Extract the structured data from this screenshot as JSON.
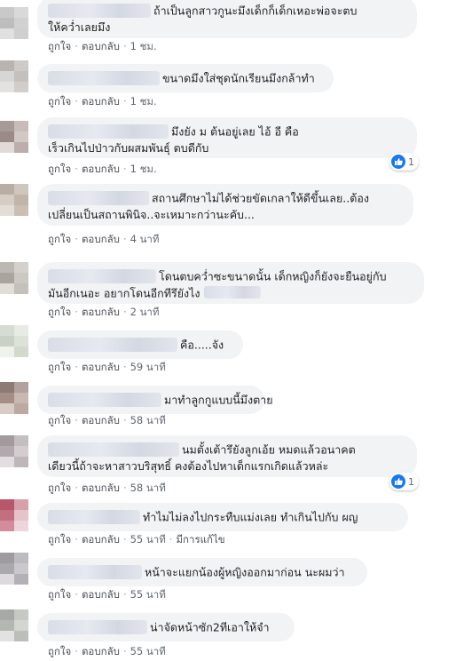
{
  "labels": {
    "like": "ถูกใจ",
    "reply": "ตอบกลับ",
    "separator": "·"
  },
  "colors": {
    "link": "#4b4f56",
    "bubble": "#f2f3f5",
    "like_blue": "#1877f2"
  },
  "comments": [
    {
      "lines": [
        "ถ้าเป็นลูกสาวกูนะมึงเด็กก็เด็กเหอะพ่อจะตบ",
        "ให้คว่ำเลยมึง"
      ],
      "time": "1 ชม."
    },
    {
      "lines": [
        "ขนาดมึงใส่ชุดนักเรียนมึงกล้าทำ"
      ],
      "time": "1 ชม."
    },
    {
      "lines": [
        "มึงยัง ม ต้นอยู่เลย ไอ้ อี คือ",
        "เร็วเกินไปป่าวกับผสมพันธุ์ ตบดีกับ"
      ],
      "time": "1 ชม.",
      "reactions": "1"
    },
    {
      "lines": [
        "สถานศึกษาไม่ได้ช่วยขัดเกลาให้ดีขึ้นเลย..ต้อง",
        "เปลี่ยนเป็นสถานพินิจ..จะเหมาะกว่านะคับ..."
      ],
      "time": "4 นาที"
    },
    {
      "lines": [
        "โดนตบคว่ำซะขนาดนั้น เด็กหญิงก็ยังจะยืนอยู่กับ",
        "มันอีกเนอะ อยากโดนอีกทีรึยังไง"
      ],
      "time": "2 นาที"
    },
    {
      "lines": [
        "คือ.....จัง"
      ],
      "time": "59 นาที"
    },
    {
      "lines": [
        "มาทำลูกกูแบบนี้มึงตาย"
      ],
      "time": "58 นาที"
    },
    {
      "lines": [
        "นมตั้งเต้ารึยังลูกเอ้ย หมดแล้วอนาคต",
        "เดียวนี้ถ้าจะหาสาวบริสุทธิ์ คงต้องไปหาเด็กแรกเกิดแล้วหล่ะ"
      ],
      "time": "58 นาที",
      "reactions": "1"
    },
    {
      "lines": [
        "ทำไมไม่ลงไปกระทืบแม่งเลย ทำเกินไปกับ ผญ"
      ],
      "time": "55 นาที",
      "edited": "มีการแก้ไข"
    },
    {
      "lines": [
        "หน้าจะแยกน้องผู้หญิงออกมาก่อน นะผมว่า"
      ],
      "time": "55 นาที"
    },
    {
      "lines": [
        "น่าจัดหน้าซัก2ทีเอาให้จำ"
      ],
      "time": "55 นาที"
    }
  ]
}
